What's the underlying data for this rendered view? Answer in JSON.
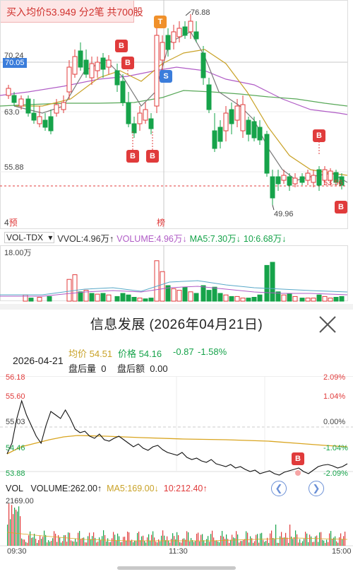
{
  "banner": "买入均价53.949 分2笔 共700股",
  "kline": {
    "price_labels": {
      "high_peak": "76.88",
      "y1": "70.24",
      "y1_highlight": "70.05",
      "y2": "63.0",
      "y3": "55.88",
      "low_peak": "49.96",
      "right_dashed": "53.56",
      "bottom_left": "4",
      "forecast": "预",
      "rank": "榜"
    },
    "markers": [
      {
        "type": "T"
      },
      {
        "type": "S"
      },
      {
        "type": "B"
      },
      {
        "type": "B"
      },
      {
        "type": "B"
      },
      {
        "type": "B"
      },
      {
        "type": "B"
      },
      {
        "type": "B"
      },
      {
        "type": "B"
      }
    ]
  },
  "indicator": {
    "selector": "VOL-TDX",
    "vvol": "VVOL:4.96万↑",
    "volume": "VOLUME:4.96万↓",
    "ma5": "MA5:7.30万↓",
    "ma10": "10:6.68万↓",
    "ymax": "18.00万"
  },
  "intraday": {
    "title": "信息发展 (2026年04月21日)",
    "date": "2026-04-21",
    "avg_price": "均价 54.51",
    "price": "价格 54.16",
    "change": "-0.87",
    "change_pct": "-1.58%",
    "after_volume_label": "盘后量",
    "after_volume": "0",
    "after_amount_label": "盘后额",
    "after_amount": "0.00",
    "left_axis": [
      "56.18",
      "55.60",
      "55.03",
      "54.46",
      "53.88"
    ],
    "right_axis": [
      "2.09%",
      "1.04%",
      "0.00%",
      "-1.04%",
      "-2.09%"
    ],
    "marker": "B",
    "vol_row": {
      "vol": "VOL",
      "volume": "VOLUME:262.00↑",
      "ma5": "MA5:169.00↓",
      "ma10": "10:212.40↑"
    },
    "vol_ymax": "2169.00",
    "time_labels": [
      "09:30",
      "11:30",
      "15:00"
    ]
  },
  "colors": {
    "up": "#e03b3b",
    "down": "#16a34a",
    "ma5": "#7a7a7a",
    "ma10": "#c9a227",
    "ma20": "#b05cc6",
    "ma60": "#58a858",
    "avg": "#d9a520",
    "price_line": "#111"
  }
}
